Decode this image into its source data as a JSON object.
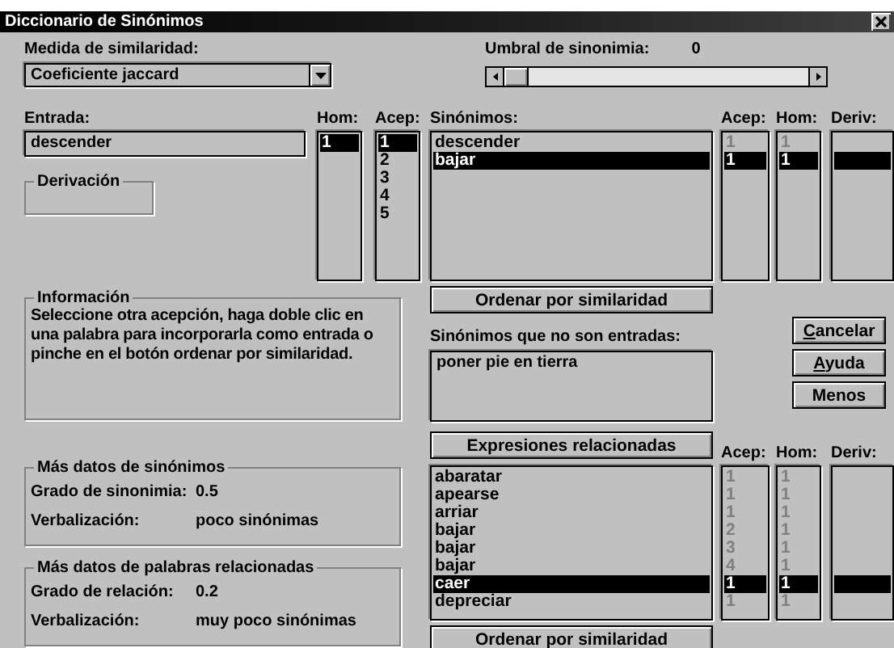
{
  "window": {
    "title": "Diccionario de Sinónimos"
  },
  "similarity": {
    "label": "Medida de similaridad:",
    "value": "Coeficiente jaccard"
  },
  "threshold": {
    "label": "Umbral de sinonimia:",
    "reading": "0",
    "level": 0
  },
  "entry": {
    "label": "Entrada:",
    "value": "descender"
  },
  "derivation": {
    "legend": "Derivación"
  },
  "hom_list": {
    "label": "Hom:",
    "items": [
      {
        "text": "1",
        "selected": true
      }
    ]
  },
  "acep_list": {
    "label": "Acep:",
    "items": [
      {
        "text": "1",
        "selected": true
      },
      {
        "text": "2",
        "selected": false
      },
      {
        "text": "3",
        "selected": false
      },
      {
        "text": "4",
        "selected": false
      },
      {
        "text": "5",
        "selected": false
      }
    ]
  },
  "synonyms": {
    "label": "Sinónimos:",
    "acep_label": "Acep:",
    "hom_label": "Hom:",
    "deriv_label": "Deriv:",
    "numbers_disabled": true,
    "rows": [
      {
        "word": "descender",
        "acep": "1",
        "hom": "1",
        "selected": false
      },
      {
        "word": "bajar",
        "acep": "1",
        "hom": "1",
        "selected": true
      }
    ]
  },
  "sort_button": "Ordenar por similaridad",
  "info": {
    "legend": "Información",
    "text": "Seleccione otra acepción, haga doble clic en una palabra para incorporarla como entrada o pinche en el botón ordenar por similaridad."
  },
  "non_entries": {
    "label": "Sinónimos que no son entradas:",
    "value": "poner pie en tierra"
  },
  "buttons": [
    {
      "label": "Cancelar",
      "underline_first": true
    },
    {
      "label": "Ayuda",
      "underline_first": true
    },
    {
      "label": "Menos",
      "underline_first": false
    }
  ],
  "related": {
    "button": "Expresiones relacionadas",
    "acep_label": "Acep:",
    "hom_label": "Hom:",
    "deriv_label": "Deriv:",
    "numbers_disabled": true,
    "rows": [
      {
        "word": "abaratar",
        "acep": "1",
        "hom": "1",
        "selected": false
      },
      {
        "word": "apearse",
        "acep": "1",
        "hom": "1",
        "selected": false
      },
      {
        "word": "arriar",
        "acep": "1",
        "hom": "1",
        "selected": false
      },
      {
        "word": "bajar",
        "acep": "2",
        "hom": "1",
        "selected": false
      },
      {
        "word": "bajar",
        "acep": "3",
        "hom": "1",
        "selected": false
      },
      {
        "word": "bajar",
        "acep": "4",
        "hom": "1",
        "selected": false
      },
      {
        "word": "caer",
        "acep": "1",
        "hom": "1",
        "selected": true
      },
      {
        "word": "depreciar",
        "acep": "1",
        "hom": "1",
        "selected": false
      }
    ],
    "sort_button": "Ordenar por similaridad"
  },
  "synonym_data": {
    "legend": "Más datos de sinónimos",
    "fields": [
      {
        "label": "Grado de sinonimia:",
        "value": "0.5"
      },
      {
        "label": "Verbalización:",
        "value": "poco sinónimas"
      }
    ]
  },
  "related_data": {
    "legend": "Más datos de palabras relacionadas",
    "fields": [
      {
        "label": "Grado de relación:",
        "value": "0.2"
      },
      {
        "label": "Verbalización:",
        "value": "muy poco sinónimas"
      }
    ]
  }
}
